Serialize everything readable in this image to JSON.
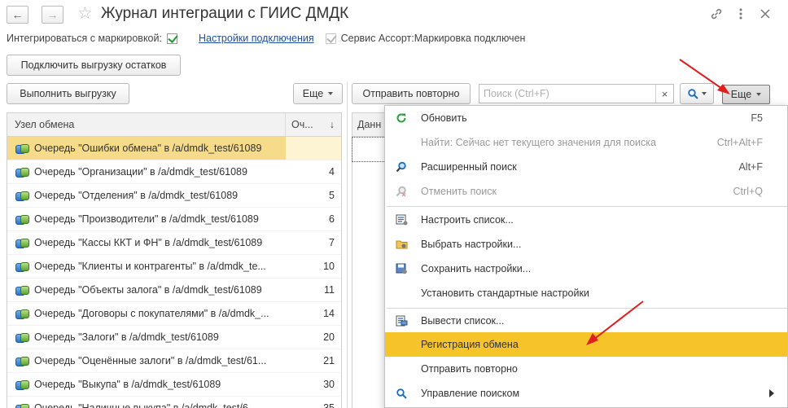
{
  "header": {
    "back_label": "←",
    "forward_label": "→",
    "title": "Журнал интеграции с ГИИС ДМДК",
    "link_icon": "chain-link-icon",
    "more_icon": "vertical-dots-icon",
    "close_icon": "close-icon"
  },
  "options": {
    "integrate_label": "Интегрироваться с маркировкой:",
    "integrate_checked": true,
    "connection_link": "Настройки подключения",
    "service_label": "Сервис Ассорт:Маркировка подключен",
    "service_checked": true
  },
  "buttons": {
    "connect_stock": "Подключить выгрузку остатков",
    "execute_upload": "Выполнить выгрузку",
    "more_left": "Еще",
    "send_again": "Отправить повторно",
    "more_right": "Еще",
    "search_clear": "×"
  },
  "search": {
    "placeholder": "Поиск (Ctrl+F)"
  },
  "left_table": {
    "col_node": "Узел обмена",
    "col_queue": "Оч...",
    "sort_indicator": "↓",
    "rows": [
      {
        "name": "Очередь \"Ошибки обмена\" в /a/dmdk_test/61089",
        "num": ""
      },
      {
        "name": "Очередь \"Организации\" в /a/dmdk_test/61089",
        "num": "4"
      },
      {
        "name": "Очередь \"Отделения\" в /a/dmdk_test/61089",
        "num": "5"
      },
      {
        "name": "Очередь \"Производители\" в /a/dmdk_test/61089",
        "num": "6"
      },
      {
        "name": "Очередь \"Кассы ККТ и ФН\" в /a/dmdk_test/61089",
        "num": "7"
      },
      {
        "name": "Очередь \"Клиенты и контрагенты\" в /a/dmdk_te...",
        "num": "10"
      },
      {
        "name": "Очередь \"Объекты залога\" в /a/dmdk_test/61089",
        "num": "11"
      },
      {
        "name": "Очередь \"Договоры с покупателями\" в /a/dmdk_...",
        "num": "14"
      },
      {
        "name": "Очередь \"Залоги\" в /a/dmdk_test/61089",
        "num": "20"
      },
      {
        "name": "Очередь \"Оценённые залоги\" в /a/dmdk_test/61...",
        "num": "21"
      },
      {
        "name": "Очередь \"Выкупа\" в /a/dmdk_test/61089",
        "num": "30"
      },
      {
        "name": "Очередь \"Наличные выкупа\" в /a/dmdk_test/6...",
        "num": "35"
      }
    ]
  },
  "right_table": {
    "col_data": "Данн"
  },
  "menu": {
    "items": [
      {
        "label": "Обновить",
        "shortcut": "F5",
        "icon": "refresh-icon"
      },
      {
        "label": "Найти: Сейчас нет текущего значения для поиска",
        "shortcut": "Ctrl+Alt+F",
        "icon": ""
      },
      {
        "label": "Расширенный поиск",
        "shortcut": "Alt+F",
        "icon": "advanced-search-icon"
      },
      {
        "label": "Отменить поиск",
        "shortcut": "Ctrl+Q",
        "icon": "cancel-search-icon"
      },
      {
        "label": "Настроить список...",
        "shortcut": "",
        "icon": "list-settings-icon"
      },
      {
        "label": "Выбрать настройки...",
        "shortcut": "",
        "icon": "select-settings-icon"
      },
      {
        "label": "Сохранить настройки...",
        "shortcut": "",
        "icon": "save-settings-icon"
      },
      {
        "label": "Установить стандартные настройки",
        "shortcut": "",
        "icon": ""
      },
      {
        "label": "Вывести список...",
        "shortcut": "",
        "icon": "print-list-icon"
      },
      {
        "label": "Регистрация обмена",
        "shortcut": "",
        "icon": ""
      },
      {
        "label": "Отправить повторно",
        "shortcut": "",
        "icon": ""
      },
      {
        "label": "Управление поиском",
        "shortcut": "",
        "icon": "search-icon"
      }
    ]
  },
  "colors": {
    "highlight": "#f6c428",
    "selected_row": "#f6dc8a",
    "link": "#2050a0",
    "annotation_arrow": "#e02020",
    "search_icon": "#1a6fc2"
  }
}
